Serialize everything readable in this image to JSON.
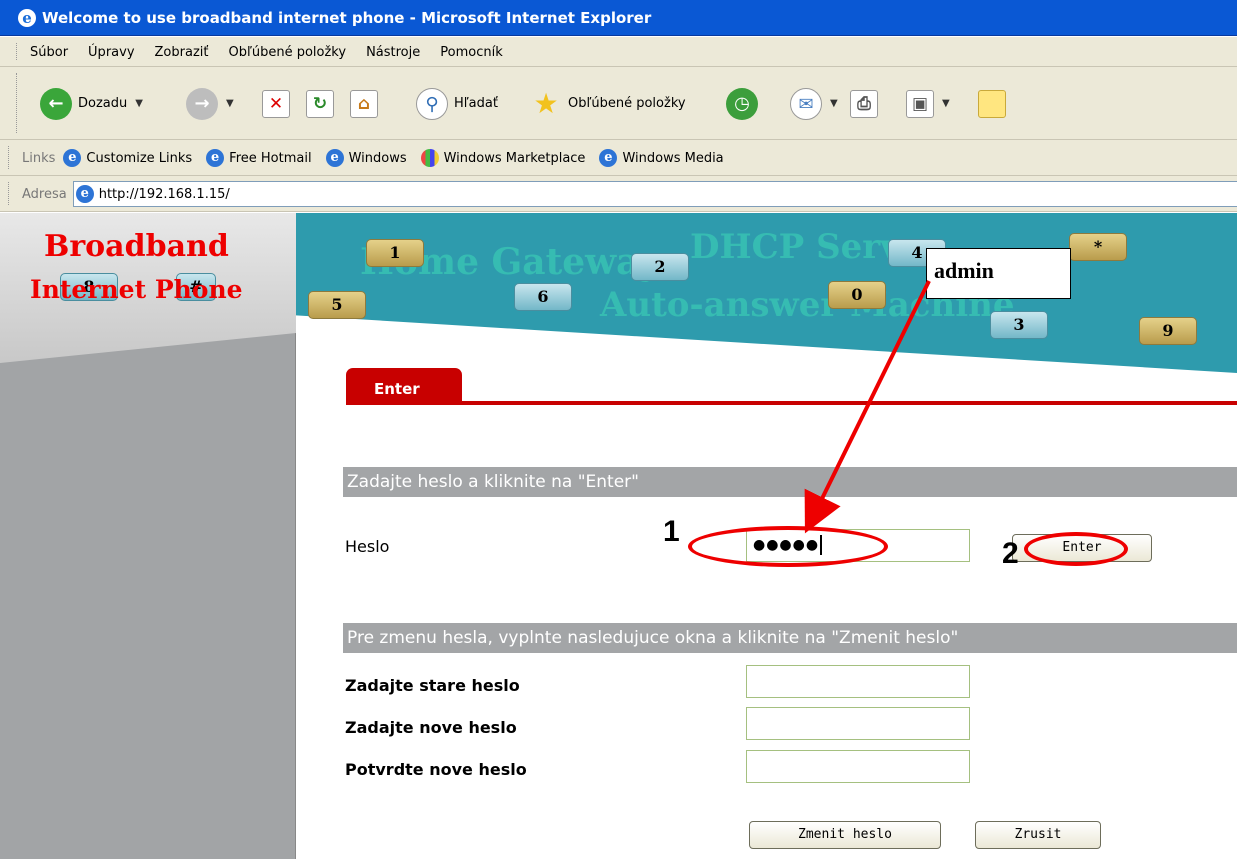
{
  "window": {
    "title": "Welcome to use broadband internet phone - Microsoft Internet Explorer"
  },
  "menu": [
    "Súbor",
    "Úpravy",
    "Zobraziť",
    "Obľúbené položky",
    "Nástroje",
    "Pomocník"
  ],
  "toolbar": {
    "back_label": "Dozadu",
    "search_label": "Hľadať",
    "favorites_label": "Obľúbené položky"
  },
  "links": {
    "label": "Links",
    "items": [
      "Customize Links",
      "Free Hotmail",
      "Windows",
      "Windows Marketplace",
      "Windows Media"
    ]
  },
  "address": {
    "label": "Adresa",
    "url": "http://192.168.1.15/"
  },
  "banner": {
    "logo_line1": "Broadband",
    "logo_line2": "Internet Phone",
    "watermark1": "Home Gateway",
    "watermark2": "DHCP Server",
    "watermark3": "Auto-answer Machine",
    "keys": [
      "1",
      "2",
      "4",
      "*",
      "5",
      "6",
      "0",
      "3",
      "9",
      "8",
      "#"
    ]
  },
  "page": {
    "tab_label": "Enter",
    "login_section": "Zadajte heslo a kliknite na \"Enter\"",
    "password_label": "Heslo",
    "password_value": "●●●●●",
    "enter_button": "Enter",
    "change_section": "Pre zmenu hesla, vyplnte nasledujuce okna a kliknite na \"Zmenit heslo\"",
    "old_password_label": "Zadajte stare heslo",
    "new_password_label": "Zadajte nove heslo",
    "confirm_password_label": "Potvrdte nove heslo",
    "change_button": "Zmenit heslo",
    "cancel_button": "Zrusit"
  },
  "annotations": {
    "callout_text": "admin",
    "step1": "1",
    "step2": "2",
    "color": "#e00000"
  }
}
